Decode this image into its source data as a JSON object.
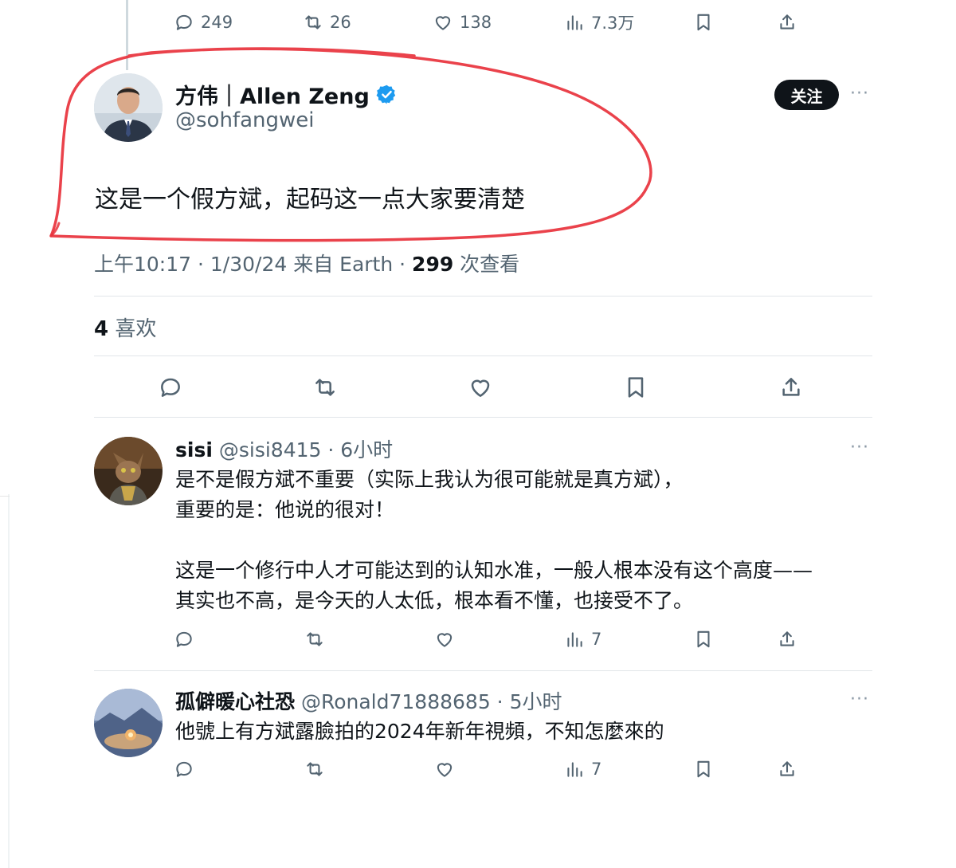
{
  "top_actions": {
    "reply_count": "249",
    "retweet_count": "26",
    "like_count": "138",
    "view_count": "7.3万"
  },
  "main_tweet": {
    "display_name": "方伟｜Allen Zeng",
    "handle": "@sohfangwei",
    "follow_label": "关注",
    "more_label": "···",
    "text": "这是一个假方斌，起码这一点大家要清楚",
    "timestamp": "上午10:17 · 1/30/24 来自 Earth · ",
    "views_count": "299",
    "views_label": " 次查看",
    "likes_count": "4",
    "likes_label": " 喜欢"
  },
  "replies": [
    {
      "display_name": "sisi",
      "handle": " @sisi8415 · 6小时",
      "text": "是不是假方斌不重要（实际上我认为很可能就是真方斌），\n重要的是：他说的很对！\n\n这是一个修行中人才可能达到的认知水准，一般人根本没有这个高度——\n其实也不高，是今天的人太低，根本看不懂，也接受不了。",
      "view_count": "7"
    },
    {
      "display_name": "孤僻暖心社恐",
      "handle": " @Ronald71888685 · 5小时",
      "text": "他號上有方斌露臉拍的2024年新年視頻，不知怎麼來的",
      "view_count": "7"
    }
  ],
  "colors": {
    "verified_badge": "#1d9bf0",
    "annotation_circle": "#e8323c",
    "secondary_text": "#536471"
  }
}
